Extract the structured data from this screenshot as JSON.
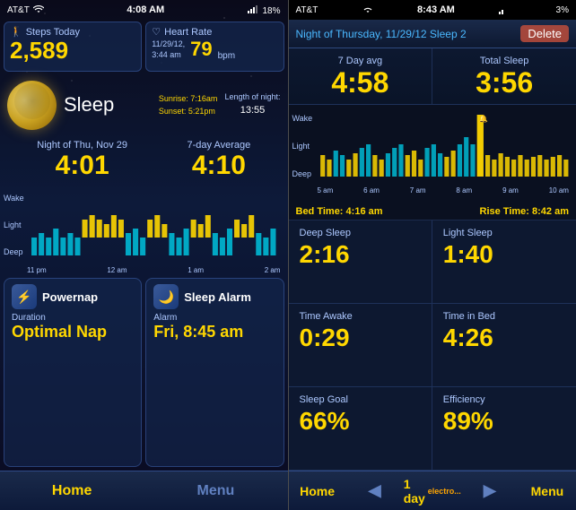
{
  "left": {
    "status": {
      "carrier": "AT&T",
      "time": "4:08 AM",
      "battery": "18%"
    },
    "steps": {
      "label": "Steps Today",
      "value": "2,589"
    },
    "heart": {
      "label": "Heart Rate",
      "date": "11/29/12,",
      "time": "3:44 am",
      "value": "79",
      "unit": "bpm"
    },
    "sleep": {
      "title": "Sleep",
      "sunrise_label": "Sunrise:",
      "sunrise_time": "7:16am",
      "sunset_label": "Sunset:",
      "sunset_time": "5:21pm",
      "length_label": "Length of night:",
      "length_value": "13:55"
    },
    "night": {
      "label": "Night of Thu, Nov 29",
      "value": "4:01",
      "avg_label": "7-day Average",
      "avg_value": "4:10"
    },
    "chart": {
      "y_labels": [
        "Wake",
        "Light",
        "Deep"
      ],
      "x_labels": [
        "11 pm",
        "12 am",
        "1 am",
        "2 am"
      ]
    },
    "powernap": {
      "title": "Powernap",
      "duration_label": "Duration",
      "duration_value": "Optimal Nap"
    },
    "alarm": {
      "title": "Sleep Alarm",
      "alarm_label": "Alarm",
      "alarm_value": "Fri, 8:45 am"
    },
    "tabs": {
      "home": "Home",
      "menu": "Menu"
    }
  },
  "right": {
    "status": {
      "carrier": "AT&T",
      "time": "8:43 AM",
      "battery": "3%"
    },
    "header": {
      "label": "Night of Thursday, 11/29/12 Sleep 2",
      "delete": "Delete"
    },
    "summary": {
      "avg_label": "7 Day avg",
      "avg_value": "4:58",
      "total_label": "Total Sleep",
      "total_value": "3:56"
    },
    "chart": {
      "y_labels": [
        "Wake",
        "Light",
        "Deep"
      ],
      "x_labels": [
        "5 am",
        "6 am",
        "7 am",
        "8 am",
        "9 am",
        "10 am"
      ]
    },
    "bedtime": {
      "bed_label": "Bed Time:",
      "bed_value": "4:16 am",
      "rise_label": "Rise Time:",
      "rise_value": "8:42 am"
    },
    "stats": {
      "deep_label": "Deep Sleep",
      "deep_value": "2:16",
      "light_label": "Light Sleep",
      "light_value": "1:40",
      "awake_label": "Time Awake",
      "awake_value": "0:29",
      "bed_label": "Time in Bed",
      "bed_value": "4:26",
      "goal_label": "Sleep Goal",
      "goal_value": "66%",
      "eff_label": "Efficiency",
      "eff_value": "89%"
    },
    "tabs": {
      "home": "Home",
      "one_day": "1 day",
      "menu": "Menu"
    }
  }
}
